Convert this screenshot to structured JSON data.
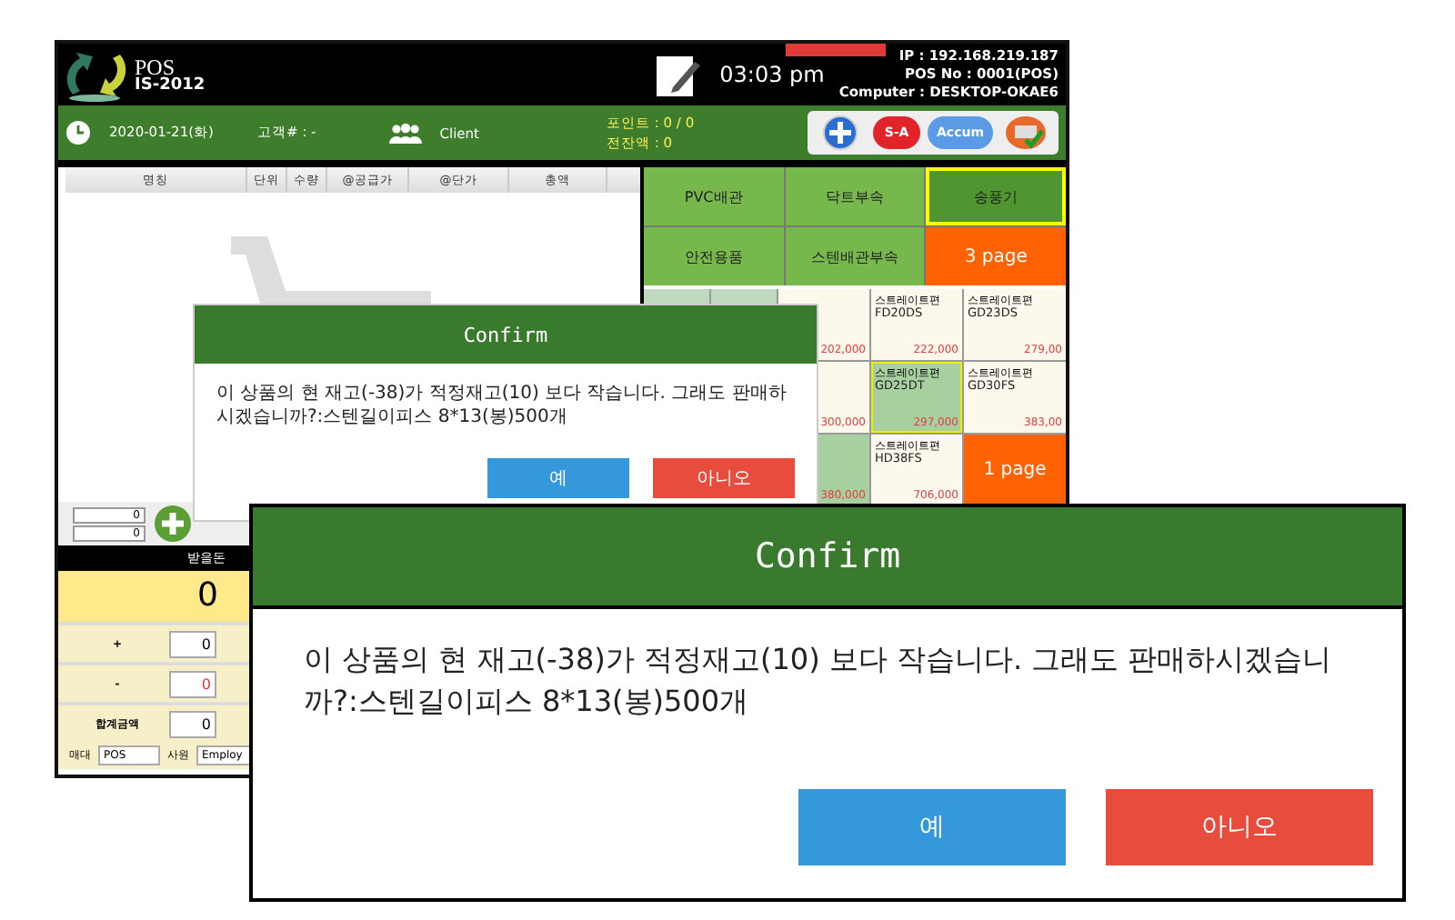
{
  "header": {
    "logo_title": "POS",
    "logo_subtitle": "IS-2012",
    "time": "03:03 pm",
    "ip": "IP : 192.168.219.187",
    "pos_no": "POS No : 0001(POS)",
    "computer": "Computer : DESKTOP-OKAE6"
  },
  "info_bar": {
    "date": "2020-01-21(화)",
    "customer": "고객# : -",
    "client": "Client",
    "points": "포인트 : 0 / 0",
    "balance": "전잔액 : 0"
  },
  "action_buttons": [
    {
      "kind": "plus"
    },
    {
      "kind": "text",
      "label": "S-A",
      "color": "#e0242a"
    },
    {
      "kind": "text",
      "label": "Accum",
      "color": "#5b9be6"
    },
    {
      "kind": "print"
    }
  ],
  "table": {
    "columns": [
      "명칭",
      "단위",
      "수량",
      "@공급가",
      "@단가",
      "총액"
    ]
  },
  "qty_fields": [
    "0",
    "0"
  ],
  "amount_due": {
    "label": "받을돈",
    "value": "0"
  },
  "summary_rows": [
    {
      "label": "+",
      "value": "0",
      "negative": false
    },
    {
      "label": "-",
      "value": "0",
      "negative": true
    },
    {
      "label": "합계금액",
      "value": "0",
      "negative": false
    }
  ],
  "footer": {
    "stand_label": "매대",
    "stand_value": "POS",
    "staff_label": "사원",
    "staff_value": "Employ"
  },
  "categories": [
    {
      "kind": "category",
      "label": "PVC배관",
      "selected": false
    },
    {
      "kind": "category",
      "label": "닥트부속",
      "selected": false
    },
    {
      "kind": "category",
      "label": "송풍기",
      "selected": true
    },
    {
      "kind": "category",
      "label": "안전용품",
      "selected": false
    },
    {
      "kind": "category",
      "label": "스텐배관부속",
      "selected": false
    },
    {
      "kind": "page",
      "label": "3 page"
    }
  ],
  "products": [
    {
      "kind": "item",
      "price": "202,000",
      "selected": false
    },
    {
      "kind": "item",
      "name": "스트레이트편",
      "code": "FD20DS",
      "price": "222,000",
      "selected": false
    },
    {
      "kind": "item",
      "name": "스트레이트편",
      "code": "GD23DS",
      "price": "279,00",
      "selected": false
    },
    {
      "kind": "item",
      "price": "300,000",
      "selected": false
    },
    {
      "kind": "item",
      "name": "스트레이트편",
      "code": "GD25DT",
      "price": "297,000",
      "selected": true
    },
    {
      "kind": "item",
      "name": "스트레이트편",
      "code": "GD30FS",
      "price": "383,00",
      "selected": false
    },
    {
      "kind": "item",
      "price": "380,000",
      "selected": true
    },
    {
      "kind": "item",
      "name": "스트레이트편",
      "code": "HD38FS",
      "price": "706,000",
      "selected": false
    },
    {
      "kind": "page",
      "label": "1 page"
    }
  ],
  "dialog": {
    "title": "Confirm",
    "message": "이 상품의 현 재고(-38)가 적정재고(10) 보다 작습니다. 그래도 판매하시겠습니까?:스텐길이피스 8*13(봉)500개",
    "buttons": [
      {
        "kind": "confirm",
        "label": "예"
      },
      {
        "kind": "cancel",
        "label": "아니오"
      }
    ]
  },
  "zoom_callout": {
    "title": "Confirm",
    "message": "이 상품의 현 재고(-38)가 적정재고(10) 보다 작습니다. 그래도 판매하시겠습니까?:스텐길이피스 8*13(봉)500개",
    "buttons": [
      {
        "kind": "confirm",
        "label": "예"
      },
      {
        "kind": "cancel",
        "label": "아니오"
      }
    ]
  }
}
